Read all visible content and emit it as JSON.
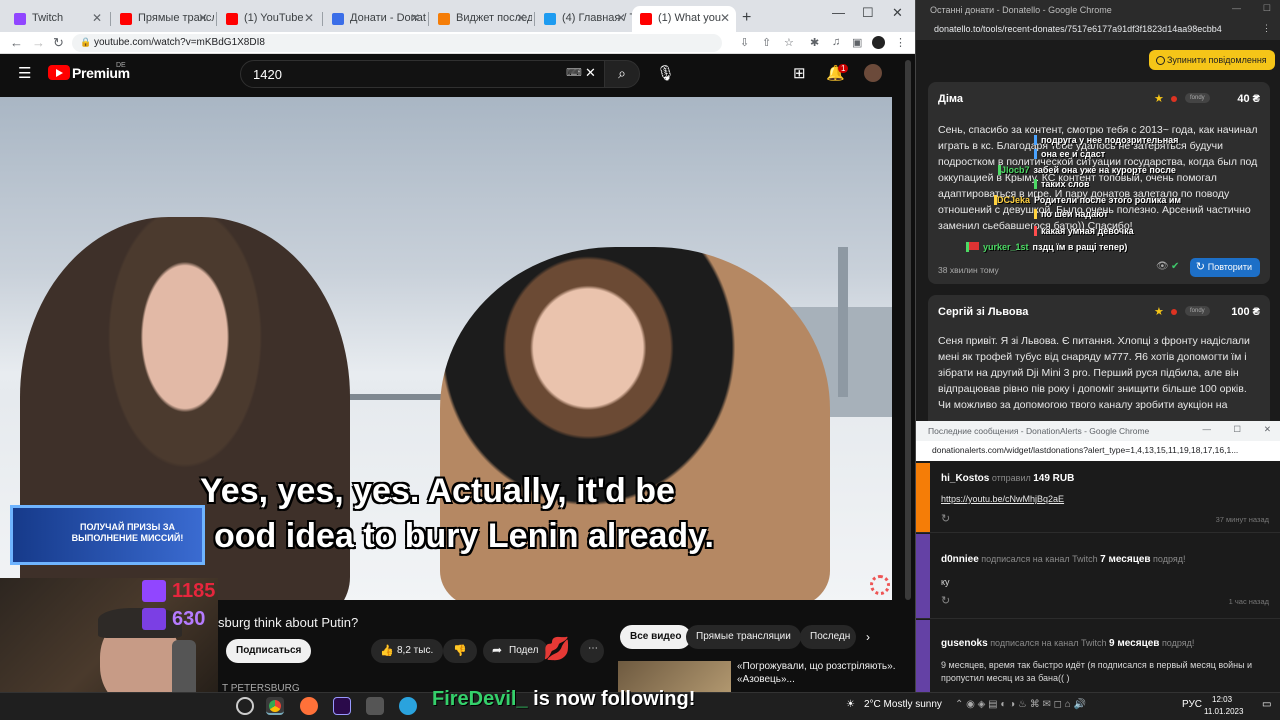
{
  "browser": {
    "tabs": [
      {
        "label": "Twitch",
        "color": "#9146ff"
      },
      {
        "label": "Прямые трансля",
        "color": "#ff0000"
      },
      {
        "label": "(1) YouTube",
        "color": "#ff0000"
      },
      {
        "label": "Донати - Donate",
        "color": "#3b6ee8"
      },
      {
        "label": "Виджет последн",
        "color": "#f57d07"
      },
      {
        "label": "(4) Главная / Tw",
        "color": "#1d9bf0"
      },
      {
        "label": "(1) What you",
        "color": "#ff0000"
      }
    ],
    "url": "youtube.com/watch?v=mKBdG1X8DI8"
  },
  "youtube": {
    "brand": "Premium",
    "region": "DE",
    "search_value": "1420",
    "notifications": "1",
    "subtitle_line1": "Yes, yes, yes. Actually, it'd be",
    "subtitle_line2": "ood idea to bury Lenin already.",
    "video_title": "sburg think about Putin?",
    "subscribe_label": "Подписаться",
    "likes": "8,2 тыс.",
    "share_label": "Подел",
    "channel": "T PETERSBURG",
    "chips": [
      "Все видео",
      "Прямые трансляции",
      "Последн"
    ],
    "rec_title": "«Погрожували, що розстріляють». «Азовець»..."
  },
  "overlay": {
    "quest_text": "ПОЛУЧАЙ ПРИЗЫ ЗА ВЫПОЛНЕНИЕ МИССИЙ!",
    "counter_top": "1185",
    "counter_bottom": "630",
    "follow_name": "FireDevil_",
    "follow_text": " is now following!"
  },
  "donatello": {
    "window_title": "Останні донати - Donatello - Google Chrome",
    "url": "donatello.to/tools/recent-donates/7517e6177a91df3f1823d14aa98ecbb4",
    "stop_label": "Зупинити повідомлення",
    "donations": [
      {
        "name": "Діма",
        "amount": "40 ₴",
        "provider": "fondy",
        "message": "Сень, спасибо за контент, смотрю тебя с 2013~ года, как начинал играть в кс. Благодаря тебе удалось не затеряться будучи подростком в политической ситуации государства, когда был под оккупацией в Крыму. КС контент топовый, очень помогал адаптироваться в игре. И пару донатов залетало по поводу отношений с девушкой. Было очень полезно. Арсений частично заменил сьебавшегося батю)) Спасибо!",
        "time": "38 хвилин тому",
        "repeat_label": "Повторити"
      },
      {
        "name": "Сергій зі Львова",
        "amount": "100 ₴",
        "provider": "fondy",
        "message": "Сеня привіт. Я зі Львова. Є питання. Хлопці з фронту надіслали мені як трофей тубус від снаряду м777. Я6 хотів допомогти їм і зібрати на другий Dji Mini 3 pro. Перший руся підбила, але він відпрацював рівно пів року і допоміг знищити більше 100 орків. Чи можливо за допомогою твого каналу зробити аукціон на"
      }
    ],
    "chat": [
      {
        "nick": "",
        "text": "подруга у нее подозрительная",
        "color": "#4aa3ff"
      },
      {
        "nick": "",
        "text": "она ее и сдаст",
        "color": "#4aa3ff"
      },
      {
        "nick": "Jlocb7",
        "text": "забей она уже на курорте после",
        "color": "#4cd964"
      },
      {
        "nick": "",
        "text": "таких слов",
        "color": "#4cd964"
      },
      {
        "nick": "DCJeka",
        "text": "Родители после этого ролика им",
        "color": "#ffd23f"
      },
      {
        "nick": "",
        "text": "по шеи надают",
        "color": "#ffd23f"
      },
      {
        "nick": "",
        "text": "какая умная девочка",
        "color": "#ff4d4d"
      },
      {
        "nick": "yurker_1st",
        "text": "пздц їм в ращі тепер)",
        "color": "#4cd964"
      }
    ]
  },
  "donationalerts": {
    "window_title": "Последние сообщения - DonationAlerts - Google Chrome",
    "url": "donationalerts.com/widget/lastdonations?alert_type=1,4,13,15,11,19,18,17,16,1...",
    "items": [
      {
        "name": "hi_Kostos",
        "action": " отправил ",
        "value": "149 RUB",
        "body": "https://youtu.be/cNwMhjBq2aE",
        "time": "37 минут назад",
        "stripe": "#f57d07"
      },
      {
        "name": "d0nniee",
        "action": " подписался на канал Twitch ",
        "value": "7 месяцев",
        "action_end": " подряд!",
        "body": "ку",
        "time": "1 час назад",
        "stripe": "#6441a5"
      },
      {
        "name": "gusenoks",
        "action": " подписался на канал Twitch ",
        "value": "9 месяцев",
        "action_end": " подряд!",
        "body": "9 месяцев, время так быстро идёт (я подписался в первый месяц войны и пропустил месяц из за бана(( )",
        "stripe": "#6441a5"
      }
    ]
  },
  "taskbar": {
    "weather": "2°C  Mostly sunny",
    "lang": "РУС",
    "time": "12:03",
    "date": "11.01.2023"
  }
}
